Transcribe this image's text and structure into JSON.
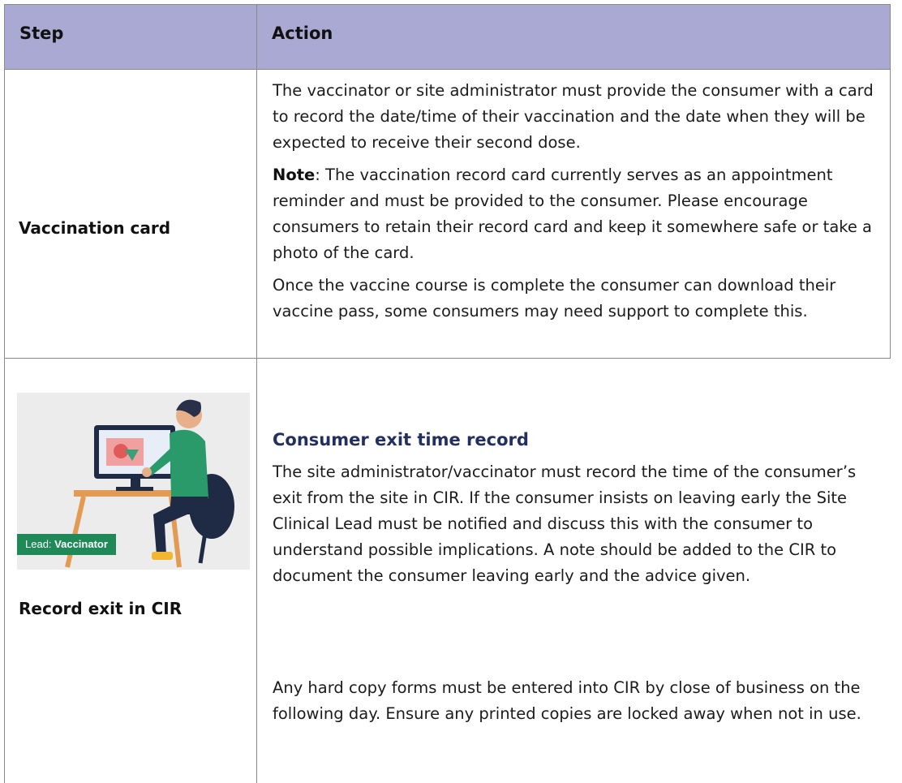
{
  "table": {
    "headers": {
      "step": "Step",
      "action": "Action"
    },
    "rows": [
      {
        "step": "Vaccination card",
        "paragraphs": [
          "The vaccinator or site administrator must provide the consumer with a card to record the date/time of their vaccination and the date when they will be expected to receive their second dose.",
          {
            "bold": "Note",
            "text": ": The vaccination record card currently serves as an appointment reminder and must be provided to the consumer. Please encourage consumers to retain their record card and keep it somewhere safe or take a photo of the card."
          },
          "Once the vaccine course is complete the consumer can download their vaccine pass, some consumers may need support to complete this."
        ]
      },
      {
        "step": "Record exit in CIR",
        "image_tag": {
          "label": "Lead: ",
          "role": "Vaccinator"
        },
        "subheading": "Consumer exit time record",
        "paragraphs": [
          "The site administrator/vaccinator must record the time of the consumer’s exit from the site in CIR. If the consumer insists on leaving early the Site Clinical Lead must be notified and discuss this with the consumer to understand possible implications. A note should be added to the CIR to document the consumer leaving early and the advice given.",
          "Any hard copy forms must be entered into CIR by close of business on the following day. Ensure any printed copies are locked away when not in use."
        ]
      }
    ]
  },
  "colors": {
    "header_bg": "#a9a9d3",
    "subheading": "#22305f",
    "lead_tag_bg": "#1f8a58"
  },
  "icons": [
    "person-at-computer-illustration"
  ]
}
